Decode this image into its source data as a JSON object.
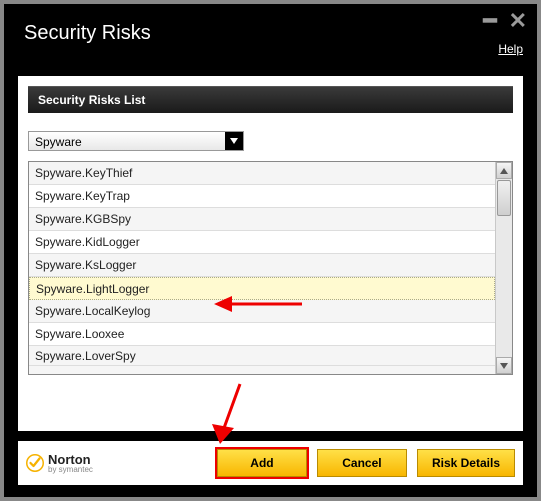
{
  "window": {
    "title": "Security Risks",
    "help": "Help"
  },
  "panel": {
    "header": "Security Risks List"
  },
  "filter": {
    "selected": "Spyware"
  },
  "risks": [
    "Spyware.KeyThief",
    "Spyware.KeyTrap",
    "Spyware.KGBSpy",
    "Spyware.KidLogger",
    "Spyware.KsLogger",
    "Spyware.LightLogger",
    "Spyware.LocalKeylog",
    "Spyware.Looxee",
    "Spyware.LoverSpy"
  ],
  "selected_index": 5,
  "buttons": {
    "add": "Add",
    "cancel": "Cancel",
    "risk_details": "Risk Details"
  },
  "brand": {
    "name": "Norton",
    "byline": "by symantec"
  }
}
